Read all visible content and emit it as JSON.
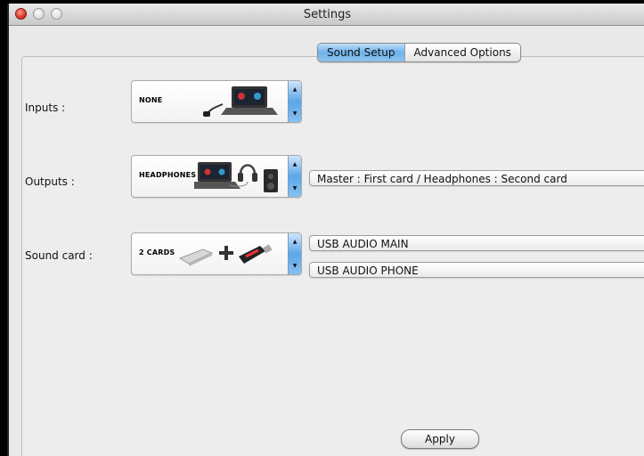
{
  "window": {
    "title": "Settings"
  },
  "tabs": [
    {
      "label": "Sound Setup",
      "selected": true
    },
    {
      "label": "Advanced Options",
      "selected": false
    }
  ],
  "inputs": {
    "label": "Inputs :",
    "value": "NONE",
    "icon": "laptop-with-cable-icon"
  },
  "outputs": {
    "label": "Outputs :",
    "value": "HEADPHONES",
    "icon": "laptop-headphones-speaker-icon",
    "routing": "Master : First card / Headphones : Second card"
  },
  "sound_card": {
    "label": "Sound card :",
    "value": "2 CARDS",
    "icon": "two-usb-cards-icon",
    "main": "USB AUDIO MAIN",
    "phone": "USB AUDIO PHONE"
  },
  "apply_label": "Apply",
  "colors": {
    "selected_tab": "#6fb1ea",
    "stepper": "#5aa6ea",
    "close_button": "#d7372b"
  }
}
